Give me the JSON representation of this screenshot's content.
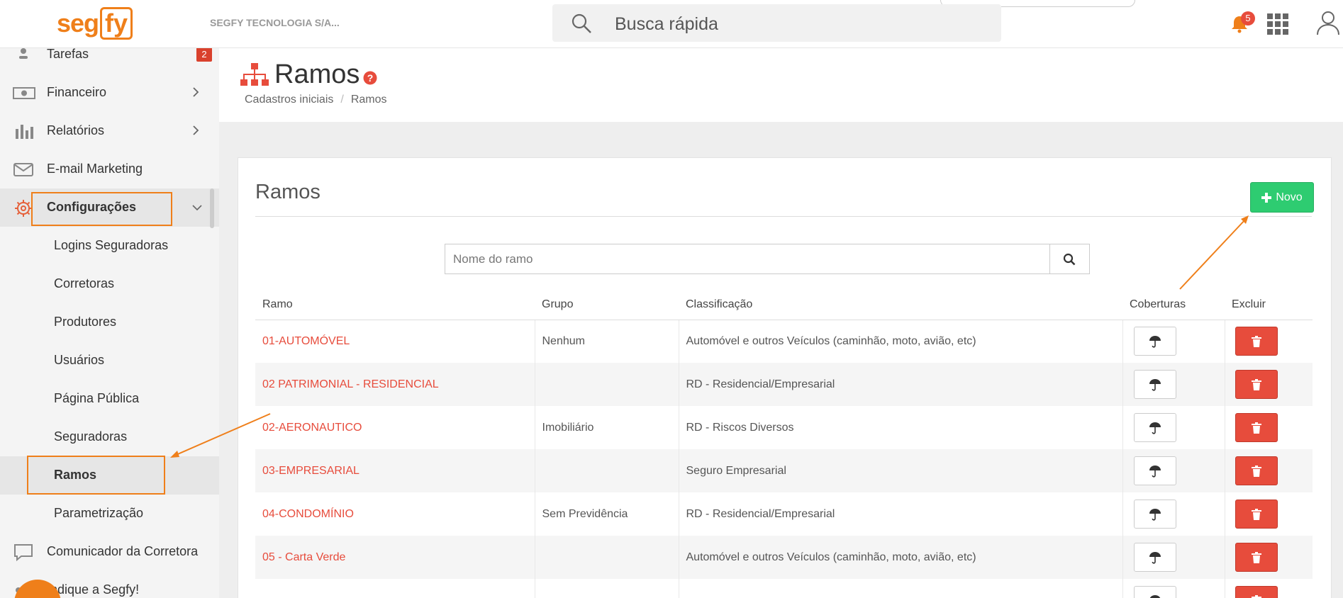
{
  "topbar": {
    "logo_part1": "seg",
    "logo_part2": "fy",
    "company": "SEGFY TECNOLOGIA S/A...",
    "search_placeholder": "Busca rápida",
    "notification_count": "5"
  },
  "sidebar": {
    "items": [
      {
        "label": "Tarefas",
        "badge": "2",
        "icon": "tasks-icon"
      },
      {
        "label": "Financeiro",
        "icon": "money-icon"
      },
      {
        "label": "Relatórios",
        "icon": "bar-chart-icon"
      },
      {
        "label": "E-mail Marketing",
        "icon": "envelope-icon"
      },
      {
        "label": "Configurações",
        "icon": "gear-icon"
      },
      {
        "label": "Comunicador da Corretora",
        "icon": "chat-icon"
      },
      {
        "label": "Indique a Segfy!",
        "icon": "share-icon"
      }
    ],
    "submenu": [
      "Logins Seguradoras",
      "Corretoras",
      "Produtores",
      "Usuários",
      "Página Pública",
      "Seguradoras",
      "Ramos",
      "Parametrização"
    ]
  },
  "page": {
    "title": "Ramos",
    "breadcrumb": [
      "Cadastros iniciais",
      "Ramos"
    ]
  },
  "card": {
    "title": "Ramos",
    "new_button": "Novo",
    "filter_placeholder": "Nome do ramo"
  },
  "table": {
    "headers": [
      "Ramo",
      "Grupo",
      "Classificação",
      "Coberturas",
      "Excluir"
    ],
    "rows": [
      {
        "ramo": "01-AUTOMÓVEL",
        "grupo": "Nenhum",
        "classificacao": "Automóvel e outros Veículos (caminhão, moto, avião, etc)"
      },
      {
        "ramo": "02 PATRIMONIAL - RESIDENCIAL",
        "grupo": "",
        "classificacao": "RD - Residencial/Empresarial"
      },
      {
        "ramo": "02-AERONAUTICO",
        "grupo": "Imobiliário",
        "classificacao": "RD - Riscos Diversos"
      },
      {
        "ramo": "03-EMPRESARIAL",
        "grupo": "",
        "classificacao": "Seguro Empresarial"
      },
      {
        "ramo": "04-CONDOMÍNIO",
        "grupo": "Sem Previdência",
        "classificacao": "RD - Residencial/Empresarial"
      },
      {
        "ramo": "05 - Carta Verde",
        "grupo": "",
        "classificacao": "Automóvel e outros Veículos (caminhão, moto, avião, etc)"
      },
      {
        "ramo": "",
        "grupo": "",
        "classificacao": ""
      }
    ]
  },
  "colors": {
    "brand": "#ef7f1a",
    "link_red": "#e74c3c",
    "new_green": "#2ecc71",
    "delete_red": "#e74c3c"
  }
}
